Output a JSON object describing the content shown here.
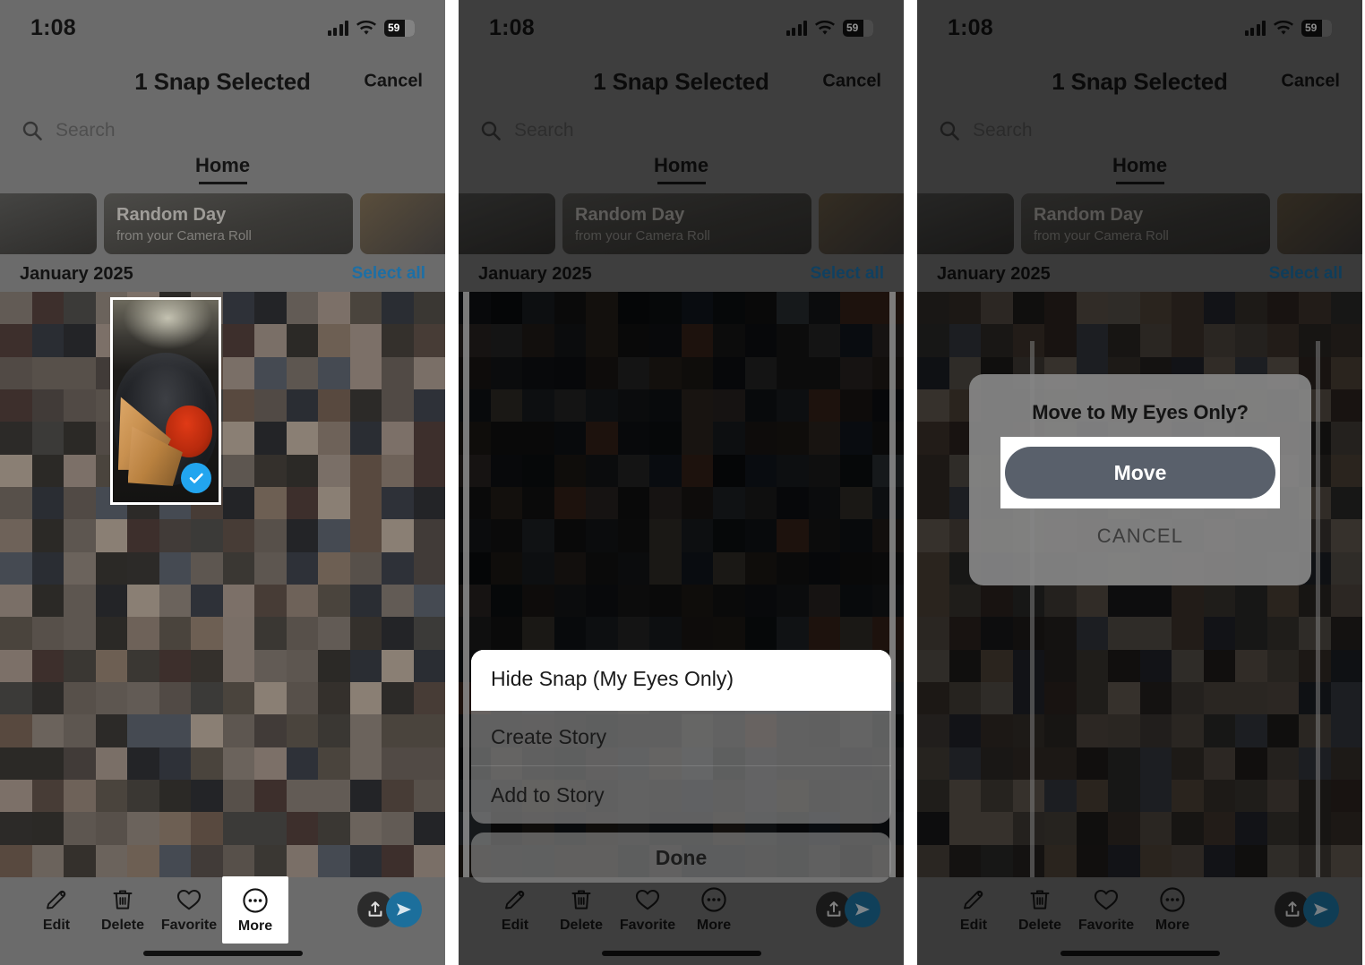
{
  "status_bar": {
    "time": "1:08",
    "battery_level": "59",
    "signal_icon": "cellular-signal-icon",
    "wifi_icon": "wifi-icon",
    "battery_icon": "battery-icon"
  },
  "header": {
    "title": "1 Snap Selected",
    "cancel_label": "Cancel"
  },
  "search": {
    "placeholder": "Search",
    "icon": "search-icon"
  },
  "tabs": {
    "active": "Home",
    "items": [
      "Home"
    ]
  },
  "story_card": {
    "title": "Random Day",
    "subtitle": "from your Camera Roll"
  },
  "section": {
    "month": "January 2025",
    "select_all": "Select all"
  },
  "toolbar": {
    "items": [
      {
        "label": "Edit",
        "icon": "pencil-icon"
      },
      {
        "label": "Delete",
        "icon": "trash-icon"
      },
      {
        "label": "Favorite",
        "icon": "heart-icon"
      },
      {
        "label": "More",
        "icon": "ellipsis-circle-icon"
      }
    ],
    "export_icon": "export-upload-icon",
    "send_icon": "send-paperplane-icon"
  },
  "action_sheet": {
    "items": [
      "Hide Snap (My Eyes Only)",
      "Create Story",
      "Add to Story"
    ],
    "highlighted_index": 0,
    "done_label": "Done"
  },
  "dialog": {
    "title": "Move to My Eyes Only?",
    "confirm_label": "Move",
    "cancel_label": "CANCEL"
  },
  "selection": {
    "checkmark_icon": "check-circle-icon",
    "selected_count": 1
  },
  "colors": {
    "accent_blue": "#1d6fa5",
    "check_blue": "#22a5ef",
    "send_blue": "#1c6f9c",
    "dialog_button": "#59606b",
    "highlight_box": "#ffffff"
  },
  "panels": [
    {
      "name": "panel-select-snap"
    },
    {
      "name": "panel-action-sheet"
    },
    {
      "name": "panel-confirm-dialog"
    }
  ]
}
